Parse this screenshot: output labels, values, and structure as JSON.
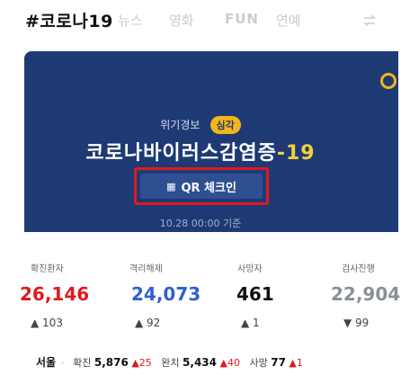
{
  "tabs": {
    "active": "#코로나19",
    "news": "뉴스",
    "video": "영화",
    "fun": "FUN",
    "etc": "연예"
  },
  "card": {
    "subtitle": "위기경보",
    "badge": "심각",
    "title_prefix": "코로나바이러스감염증",
    "title_suffix": "-19",
    "qr_label": "QR 체크인",
    "timestamp": "10.28 00:00 기준"
  },
  "stats": {
    "labels": [
      "확진환자",
      "격리해제",
      "사망자",
      "검사진행"
    ],
    "values": [
      "26,146",
      "24,073",
      "461",
      "22,904"
    ],
    "deltas": [
      "▲ 103",
      "▲ 92",
      "▲ 1",
      "▼ 99"
    ]
  },
  "footer": {
    "region": "서울",
    "confirmed_label": "확진",
    "confirmed_value": "5,876",
    "confirmed_delta": "▲25",
    "released_label": "완치",
    "released_value": "5,434",
    "released_delta": "▲40",
    "death_label": "사망",
    "death_value": "77",
    "death_delta": "▲1"
  },
  "colors": {
    "card_bg": "#1e3a74",
    "accent_yellow": "#f2b617",
    "red": "#e0191e",
    "blue": "#2f5fd0",
    "dark_text": "#111111"
  },
  "icons": [
    "refresh-icon",
    "coin-icon",
    "qr-icon"
  ]
}
